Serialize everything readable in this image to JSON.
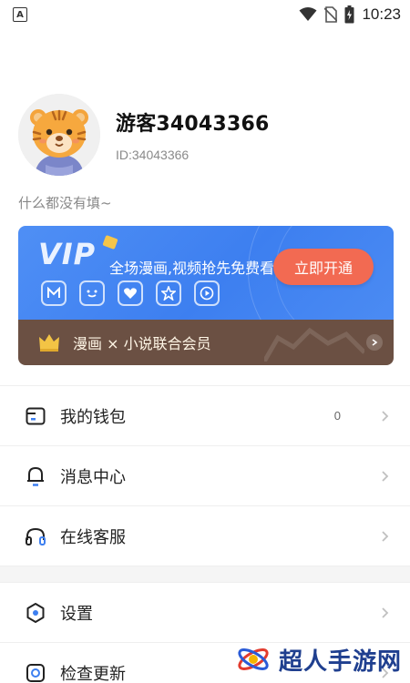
{
  "status_bar": {
    "app_indicator": "A",
    "time": "10:23",
    "icons": [
      "wifi-icon",
      "no-sim-icon",
      "battery-icon"
    ]
  },
  "profile": {
    "username": "游客34043366",
    "user_id": "ID:34043366",
    "bio": "什么都没有填~",
    "avatar": "tiger-avatar"
  },
  "vip": {
    "logo": "VIP",
    "slogan": "全场漫画,视频抢先免费看",
    "open_button": "立即开通",
    "benefits": [
      "comic-icon",
      "face-icon",
      "heart-icon",
      "badge-icon",
      "play-icon"
    ],
    "combo_label": "漫画 × 小说联合会员"
  },
  "menu": {
    "items": [
      {
        "label": "我的钱包",
        "value": "0",
        "icon": "wallet-icon"
      },
      {
        "label": "消息中心",
        "icon": "bell-icon"
      },
      {
        "label": "在线客服",
        "icon": "headset-icon"
      }
    ],
    "items2": [
      {
        "label": "设置",
        "icon": "settings-icon"
      },
      {
        "label": "检查更新",
        "icon": "update-icon"
      }
    ]
  },
  "watermark": {
    "text": "超人手游网"
  },
  "colors": {
    "vip_blue": "#3d7ff0",
    "vip_button": "#f26a52",
    "combo_brown": "#6b5043"
  }
}
